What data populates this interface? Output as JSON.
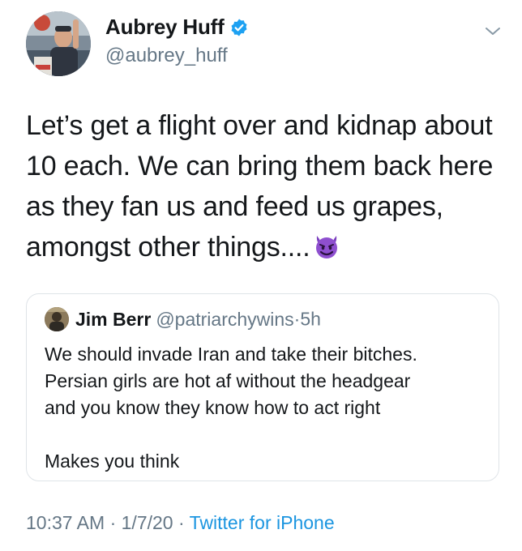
{
  "author": {
    "display_name": "Aubrey Huff",
    "handle": "@aubrey_huff",
    "verified": true
  },
  "tweet": {
    "lines": [
      "Let’s get a flight over and kidnap about",
      "10 each. We can bring them back here",
      "as they fan us and feed us grapes,",
      "amongst other things...."
    ],
    "emoji": "smiling-face-with-horns"
  },
  "quoted_tweet": {
    "display_name": "Jim Berr",
    "handle": "@patriarchywins",
    "separator": "·",
    "time": "5h",
    "lines": [
      "We should invade Iran and take their bitches.",
      "Persian girls are hot af without the headgear",
      "and you know they know how to act right"
    ],
    "closing": "Makes you think"
  },
  "meta": {
    "time": "10:37 AM",
    "sep1": "·",
    "date": "1/7/20",
    "sep2": "·",
    "source": "Twitter for iPhone"
  },
  "colors": {
    "link": "#1b95e0",
    "muted": "#657786",
    "text": "#14171a",
    "border": "#dfe4e8",
    "verified": "#1da1f2",
    "emoji": "#7b3fbf"
  }
}
